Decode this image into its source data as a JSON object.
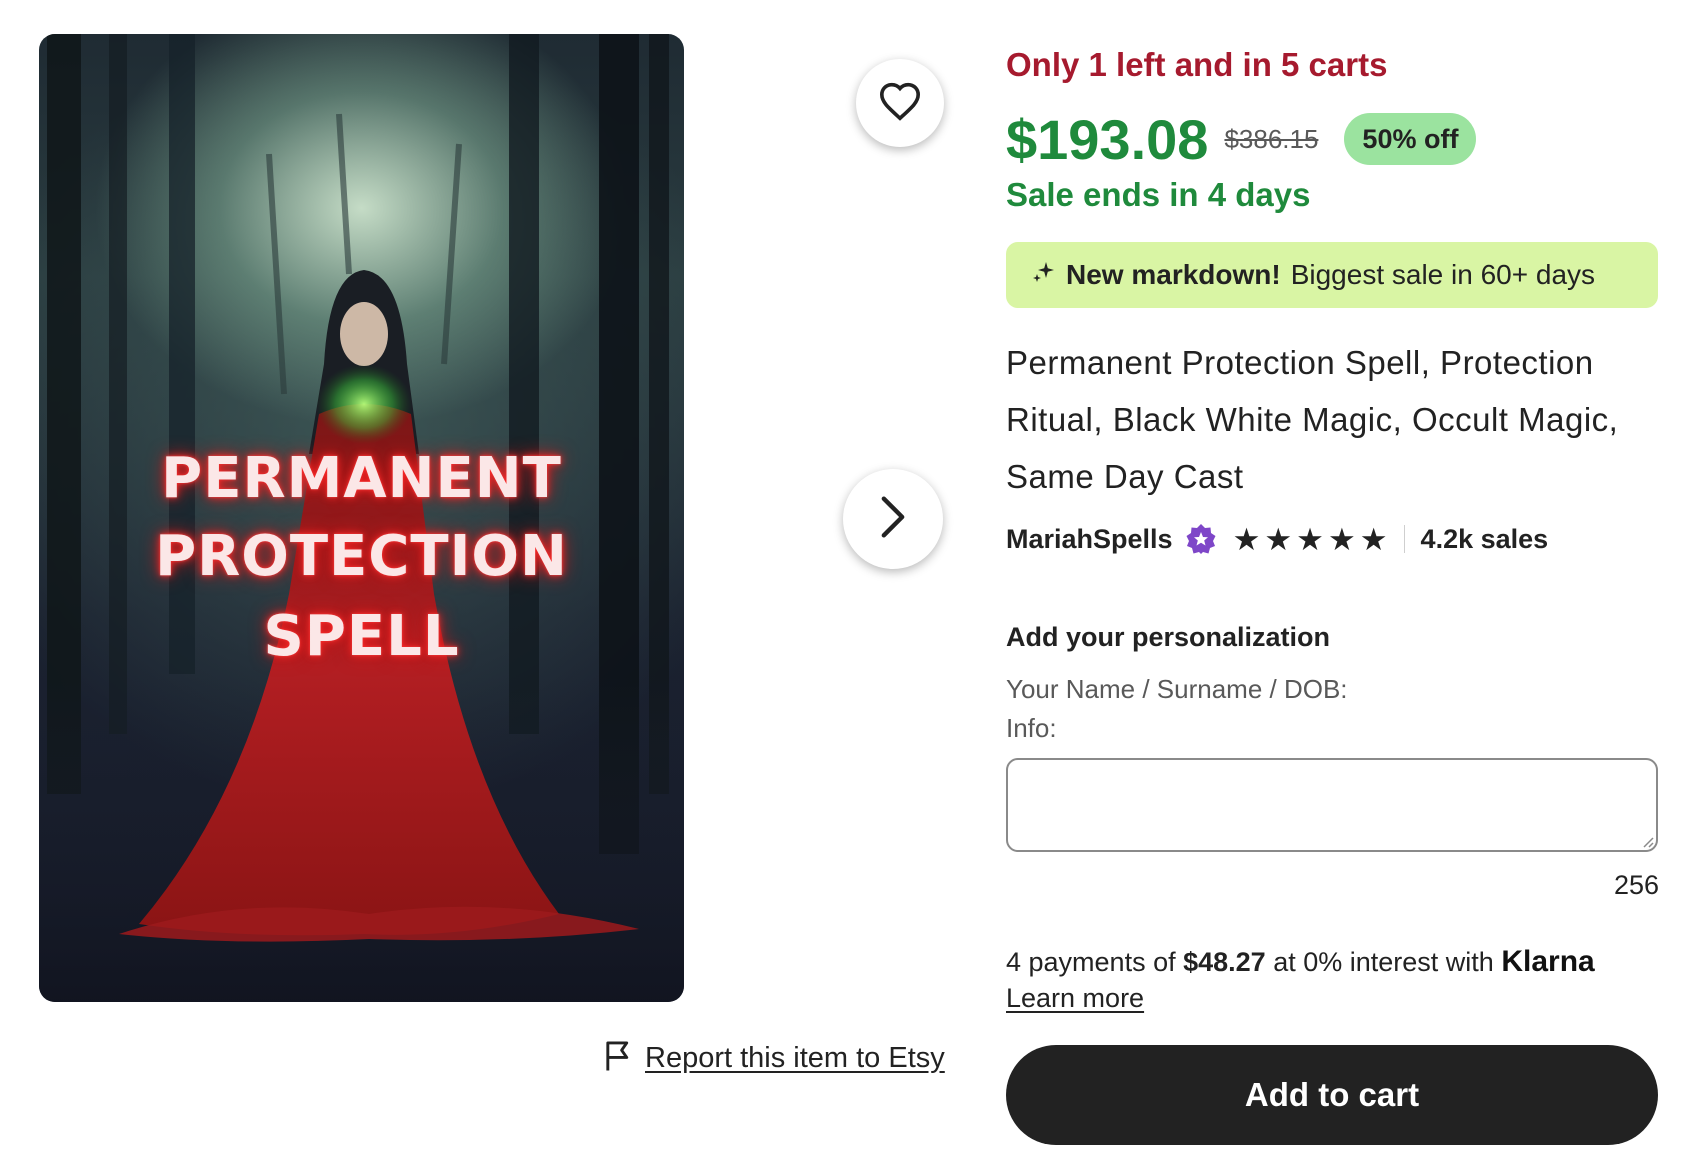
{
  "listing": {
    "image_text": [
      "PERMANENT",
      "PROTECTION",
      "SPELL"
    ],
    "scarcity": "Only 1 left and in 5 carts",
    "price": {
      "sale": "$193.08",
      "original": "$386.15",
      "discount_badge": "50% off",
      "sale_ends": "Sale ends in 4 days"
    },
    "markdown_banner": {
      "strong": "New markdown!",
      "text": "Biggest sale in 60+ days"
    },
    "title": "Permanent Protection Spell, Protection Ritual, Black White Magic, Occult Magic, Same Day Cast",
    "seller": {
      "name": "MariahSpells",
      "rating_stars": 5,
      "sales": "4.2k sales"
    },
    "personalization": {
      "heading": "Add your personalization",
      "instruction_line_1": "Your Name / Surname / DOB:",
      "instruction_line_2": "Info:",
      "value": "",
      "char_count": "256"
    },
    "klarna": {
      "prefix": "4 payments of",
      "amount": "$48.27",
      "middle": "at 0% interest with",
      "brand": "Klarna",
      "learn_more": "Learn more"
    },
    "add_to_cart_label": "Add to cart",
    "report_label": "Report this item to Etsy"
  },
  "colors": {
    "scarcity_red": "#a61a2e",
    "sale_green": "#1f8a3c",
    "badge_green": "#9be39f",
    "banner_lime": "#d9f5a4",
    "button_dark": "#222222"
  },
  "icons": {
    "favorite": "heart-outline-icon",
    "next": "chevron-right-icon",
    "report": "flag-icon",
    "banner": "sparkle-icon",
    "star_seller": "star-seller-badge-icon",
    "rating": "star-icon"
  }
}
